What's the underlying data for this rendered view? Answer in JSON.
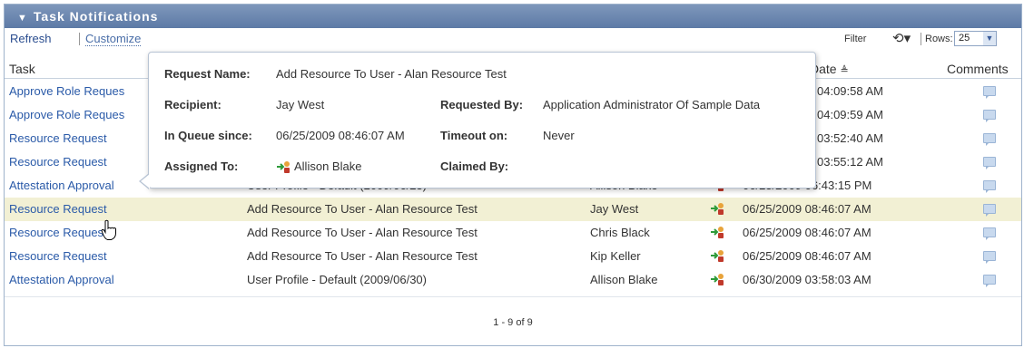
{
  "panel": {
    "title": "Task Notifications"
  },
  "toolbar": {
    "refresh": "Refresh",
    "customize": "Customize",
    "filter": "Filter",
    "rows_label": "Rows:",
    "rows_value": "25"
  },
  "columns": {
    "task": "Task",
    "date": "Date",
    "comments": "Comments"
  },
  "rows": [
    {
      "task": "Approve Role Reques",
      "request": "",
      "recipient": "",
      "date": "04:09:58 AM"
    },
    {
      "task": "Approve Role Reques",
      "request": "",
      "recipient": "",
      "date": "04:09:59 AM"
    },
    {
      "task": "Resource Request",
      "request": "",
      "recipient": "",
      "date": "03:52:40 AM"
    },
    {
      "task": "Resource Request",
      "request": "",
      "recipient": "",
      "date": "03:55:12 AM"
    },
    {
      "task": "Attestation Approval",
      "request": "User Profile - Default (2009/06/23)",
      "recipient": "Allison Blake",
      "date": "06/23/2009 06:43:15 PM"
    },
    {
      "task": "Resource Request",
      "request": "Add Resource To User - Alan Resource Test",
      "recipient": "Jay West",
      "date": "06/25/2009 08:46:07 AM"
    },
    {
      "task": "Resource Request",
      "request": "Add Resource To User - Alan Resource Test",
      "recipient": "Chris Black",
      "date": "06/25/2009 08:46:07 AM"
    },
    {
      "task": "Resource Request",
      "request": "Add Resource To User - Alan Resource Test",
      "recipient": "Kip Keller",
      "date": "06/25/2009 08:46:07 AM"
    },
    {
      "task": "Attestation Approval",
      "request": "User Profile - Default (2009/06/30)",
      "recipient": "Allison Blake",
      "date": "06/30/2009 03:58:03 AM"
    }
  ],
  "pager": "1 - 9 of 9",
  "popup": {
    "request_name_label": "Request Name:",
    "request_name": "Add Resource To User - Alan Resource Test",
    "recipient_label": "Recipient:",
    "recipient": "Jay West",
    "requested_by_label": "Requested By:",
    "requested_by": "Application Administrator Of Sample Data",
    "queue_label": "In Queue since:",
    "queue": "06/25/2009 08:46:07 AM",
    "timeout_label": "Timeout on:",
    "timeout": "Never",
    "assigned_label": "Assigned To:",
    "assigned": "Allison Blake",
    "claimed_label": "Claimed By:",
    "claimed": ""
  },
  "colors": {
    "titlebar": "#5d7aa6",
    "link": "#2a5aa8",
    "highlight": "#f2f0d4"
  }
}
